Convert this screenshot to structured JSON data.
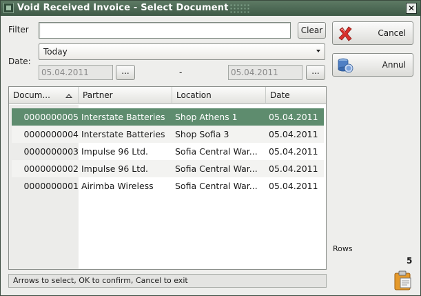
{
  "window": {
    "title": "Void Received Invoice - Select Document",
    "close_glyph": "✕"
  },
  "filter": {
    "label": "Filter",
    "value": "",
    "placeholder": "",
    "clear_label": "Clear"
  },
  "date": {
    "label": "Date:",
    "range_selected": "Today",
    "from": "05.04.2011",
    "to": "05.04.2011",
    "separator": "-",
    "browse_label": "..."
  },
  "grid": {
    "columns": [
      "Docum...",
      "Partner",
      "Location",
      "Date"
    ],
    "sort_column": "Docum...",
    "rows": [
      {
        "doc": "0000000005",
        "partner": "Interstate Batteries",
        "location": "Shop Athens 1",
        "date": "05.04.2011",
        "selected": true
      },
      {
        "doc": "0000000004",
        "partner": "Interstate Batteries",
        "location": "Shop Sofia 3",
        "date": "05.04.2011",
        "selected": false
      },
      {
        "doc": "0000000003",
        "partner": "Impulse 96 Ltd.",
        "location": "Sofia Central War...",
        "date": "05.04.2011",
        "selected": false
      },
      {
        "doc": "0000000002",
        "partner": "Impulse 96 Ltd.",
        "location": "Sofia Central War...",
        "date": "05.04.2011",
        "selected": false
      },
      {
        "doc": "0000000001",
        "partner": "Airimba Wireless",
        "location": "Sofia Central War...",
        "date": "05.04.2011",
        "selected": false
      }
    ]
  },
  "status_text": "Arrows to select, OK to confirm, Cancel to exit",
  "actions": {
    "cancel_label": "Cancel",
    "annul_label": "Annul",
    "cancel_icon": "red-x-icon",
    "annul_icon": "database-void-icon"
  },
  "rows_info": {
    "label": "Rows",
    "count": "5"
  },
  "colors": {
    "title_bar": "#4a6a53",
    "selection": "#5e8c6e",
    "cancel_x": "#d9302b"
  }
}
